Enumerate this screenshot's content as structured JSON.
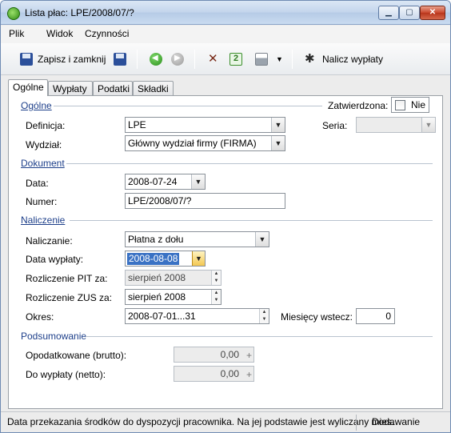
{
  "window": {
    "title": "Lista płac: LPE/2008/07/?"
  },
  "menu": {
    "items": [
      "Plik",
      "Widok",
      "Czynności"
    ]
  },
  "toolbar": {
    "save_close": "Zapisz i zamknij",
    "calculate": "Nalicz wypłaty"
  },
  "tabs": [
    "Ogólne",
    "Wypłaty",
    "Podatki",
    "Składki"
  ],
  "general": {
    "section": "Ogólne",
    "approved_label": "Zatwierdzona:",
    "approved_value": "Nie",
    "definition_label": "Definicja:",
    "definition_value": "LPE",
    "series_label": "Seria:",
    "series_value": "",
    "department_label": "Wydział:",
    "department_value": "Główny wydział firmy (FIRMA)"
  },
  "document": {
    "section": "Dokument",
    "date_label": "Data:",
    "date_value": "2008-07-24",
    "number_label": "Numer:",
    "number_value": "LPE/2008/07/?"
  },
  "accrual": {
    "section": "Naliczenie",
    "mode_label": "Naliczanie:",
    "mode_value": "Płatna z dołu",
    "payout_date_label": "Data wypłaty:",
    "payout_date_value": "2008-08-08",
    "pit_label": "Rozliczenie PIT za:",
    "pit_value": "sierpień 2008",
    "zus_label": "Rozliczenie ZUS za:",
    "zus_value": "sierpień 2008",
    "period_label": "Okres:",
    "period_value": "2008-07-01...31",
    "months_back_label": "Miesięcy wstecz:",
    "months_back_value": "0"
  },
  "summary": {
    "section": "Podsumowanie",
    "taxable_label": "Opodatkowane (brutto):",
    "taxable_value": "0,00",
    "net_label": "Do wypłaty (netto):",
    "net_value": "0,00"
  },
  "status": {
    "message": "Data przekazania środków do dyspozycji pracownika. Na jej podstawie jest wyliczany mies.",
    "mode": "Dodawanie"
  },
  "icons": [
    "app-icon",
    "save-icon",
    "save-as-icon",
    "back-icon",
    "forward-icon",
    "tools-icon",
    "refresh-icon",
    "print-icon",
    "wand-icon"
  ]
}
